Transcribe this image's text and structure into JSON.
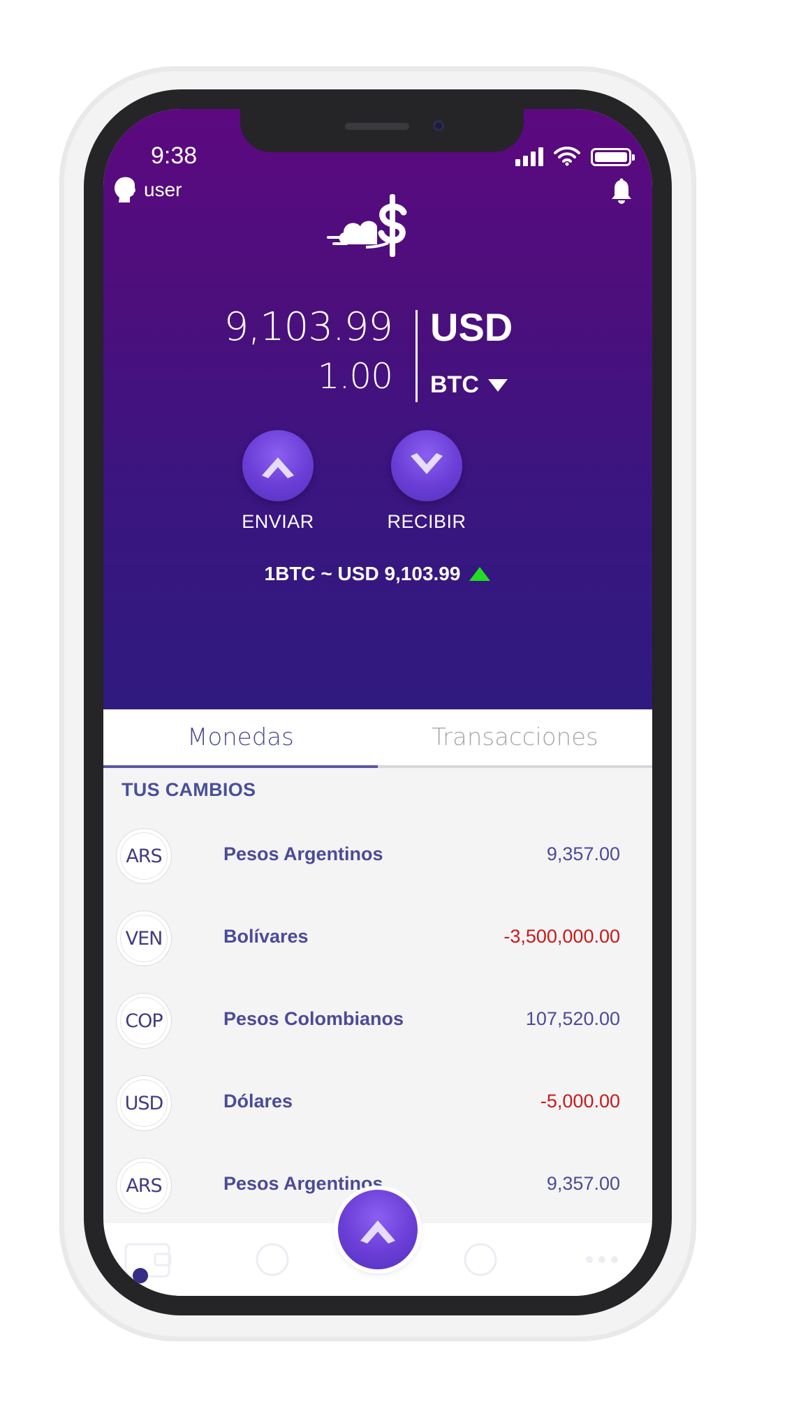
{
  "status_bar": {
    "time": "9:38"
  },
  "header": {
    "user_label": "user"
  },
  "balance": {
    "primary_amount": "9,103.99",
    "primary_currency": "USD",
    "secondary_amount": "1.00",
    "secondary_currency": "BTC"
  },
  "actions": {
    "send_label": "ENVIAR",
    "receive_label": "RECIBIR"
  },
  "rate": {
    "text": "1BTC ~ USD 9,103.99",
    "trend": "up",
    "trend_color": "#22dd22"
  },
  "tabs": [
    {
      "label": "Monedas",
      "active": true
    },
    {
      "label": "Transacciones",
      "active": false
    }
  ],
  "section": {
    "title": "TUS CAMBIOS"
  },
  "currencies": [
    {
      "code": "ARS",
      "name": "Pesos Argentinos",
      "value": "9,357.00",
      "negative": false
    },
    {
      "code": "VEN",
      "name": "Bolívares",
      "value": "-3,500,000.00",
      "negative": true
    },
    {
      "code": "COP",
      "name": "Pesos Colombianos",
      "value": "107,520.00",
      "negative": false
    },
    {
      "code": "USD",
      "name": "Dólares",
      "value": "-5,000.00",
      "negative": true
    },
    {
      "code": "ARS",
      "name": "Pesos Argentinos",
      "value": "9,357.00",
      "negative": false
    }
  ],
  "colors": {
    "hero_top": "#5c097f",
    "hero_bottom": "#2f1a80",
    "accent": "#6a3ed6",
    "text_primary": "#4b4b97",
    "negative": "#c8191a"
  },
  "icons": {
    "user": "user-silhouette-icon",
    "notifications": "bell-icon",
    "logo": "cloud-dollar-logo",
    "send": "chevron-up-icon",
    "receive": "chevron-down-icon",
    "currency_dropdown": "caret-down-icon",
    "trend": "triangle-up-icon",
    "fab": "chevron-up-icon"
  }
}
